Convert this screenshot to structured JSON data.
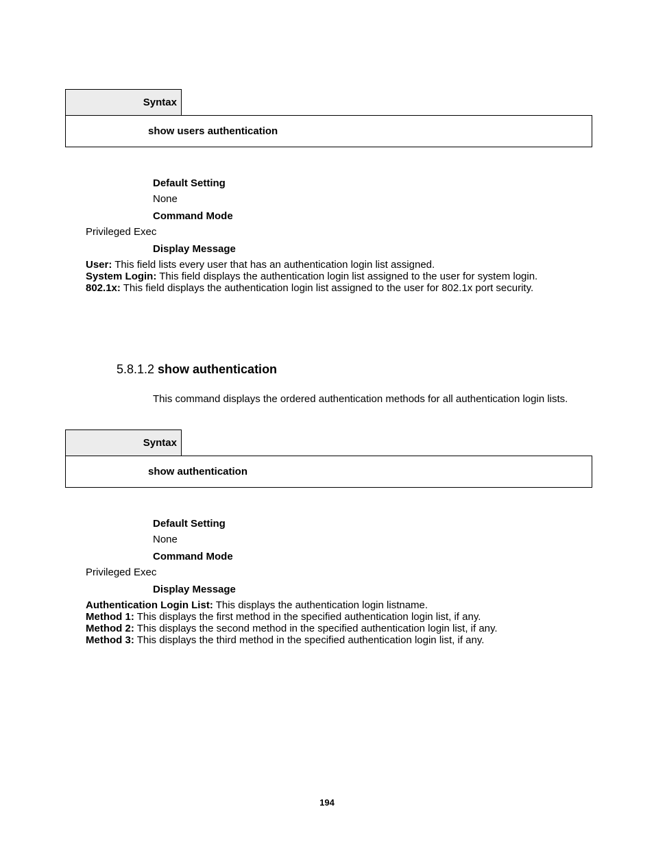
{
  "syntax1": {
    "label": "Syntax",
    "command": "show users authentication"
  },
  "block1": {
    "defaultSettingLabel": "Default Setting",
    "defaultSettingValue": "None",
    "commandModeLabel": "Command Mode",
    "commandModeValue": "Privileged Exec",
    "displayMessageLabel": "Display Message",
    "fields": {
      "user": {
        "name": "User:",
        "desc": " This field lists every user that has an authentication login list assigned."
      },
      "systemLogin": {
        "name": "System Login:",
        "desc": " This field displays the authentication login list assigned to the user for system login."
      },
      "dot1x": {
        "name": "802.1x:",
        "desc": " This field displays the authentication login list assigned to the user for 802.1x port security."
      }
    }
  },
  "section2": {
    "number": "5.8.1.2 ",
    "title": "show authentication",
    "description": "This command displays the ordered authentication methods for all authentication login lists."
  },
  "syntax2": {
    "label": "Syntax",
    "command": "show authentication"
  },
  "block2": {
    "defaultSettingLabel": "Default Setting",
    "defaultSettingValue": "None",
    "commandModeLabel": "Command Mode",
    "commandModeValue": "Privileged Exec",
    "displayMessageLabel": "Display Message",
    "fields": {
      "all": {
        "name": "Authentication Login List:",
        "desc": " This displays the authentication login listname."
      },
      "m1": {
        "name": "Method 1:",
        "desc": " This displays the first method in the specified authentication login list, if any."
      },
      "m2": {
        "name": "Method 2:",
        "desc": " This displays the second method in the specified authentication login list, if any."
      },
      "m3": {
        "name": "Method 3:",
        "desc": " This displays the third method in the specified authentication login list, if any."
      }
    }
  },
  "pageNumber": "194"
}
